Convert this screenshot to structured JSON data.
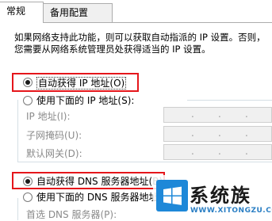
{
  "tabs": [
    {
      "label": "常规",
      "active": true
    },
    {
      "label": "备用配置",
      "active": false
    }
  ],
  "description": {
    "line1": "如果网络支持此功能，则可以获取自动指派的 IP 设置。否则，",
    "line2": "您需要从网络系统管理员处获得适当的 IP 设置。"
  },
  "ip": {
    "auto_label": "自动获得 IP 地址(O)",
    "manual_label": "使用下面的 IP 地址(S):",
    "fields": [
      {
        "label": "IP 地址(I):",
        "value": ". . ."
      },
      {
        "label": "子网掩码(U):",
        "value": ". . ."
      },
      {
        "label": "默认网关(D):",
        "value": ". . ."
      }
    ]
  },
  "dns": {
    "auto_label": "自动获得 DNS 服务器地址(B)",
    "manual_label": "使用下面的 DNS 服务器地址(E):",
    "fields": [
      {
        "label": "首选 DNS 服务器(P):",
        "value": ""
      }
    ]
  },
  "watermark": {
    "text": "系统族",
    "url": "WWW.XITONGZU.COM",
    "colors": {
      "logo_blue": "#1e88d8",
      "text": "#1a1a1a",
      "url": "#2b7fc4"
    }
  },
  "colors": {
    "highlight_box": "#e5161b",
    "disabled_text": "#8a8a8a"
  }
}
